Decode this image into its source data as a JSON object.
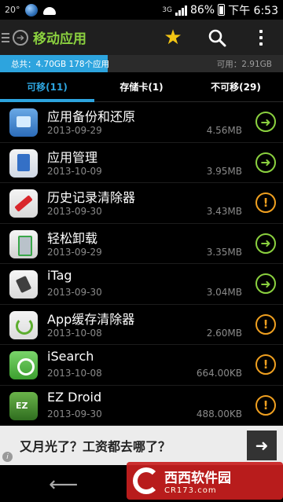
{
  "status_bar": {
    "temperature": "20°",
    "network_type": "3G",
    "battery": "86%",
    "time": "下午 6:53"
  },
  "action_bar": {
    "title": "移动应用",
    "icons": [
      "menu-icon",
      "app-icon",
      "star-icon",
      "search-icon",
      "overflow-icon"
    ]
  },
  "storage": {
    "total_label": "总共：4.70GB  178个应用",
    "free_label": "可用：2.91GB",
    "used_fraction": 0.38,
    "accent_color": "#2da4de"
  },
  "tabs": [
    {
      "label": "可移(11)",
      "active": true
    },
    {
      "label": "存储卡(1)",
      "active": false
    },
    {
      "label": "不可移(29)",
      "active": false
    }
  ],
  "apps": [
    {
      "name": "应用备份和还原",
      "date": "2013-09-29",
      "size": "4.56MB",
      "status": "move"
    },
    {
      "name": "应用管理",
      "date": "2013-10-09",
      "size": "3.95MB",
      "status": "move"
    },
    {
      "name": "历史记录清除器",
      "date": "2013-09-30",
      "size": "3.43MB",
      "status": "warn"
    },
    {
      "name": "轻松卸载",
      "date": "2013-09-29",
      "size": "3.35MB",
      "status": "move"
    },
    {
      "name": "iTag",
      "date": "2013-09-30",
      "size": "3.04MB",
      "status": "move"
    },
    {
      "name": "App缓存清除器",
      "date": "2013-10-08",
      "size": "2.60MB",
      "status": "warn"
    },
    {
      "name": "iSearch",
      "date": "2013-10-08",
      "size": "664.00KB",
      "status": "warn"
    },
    {
      "name": "EZ Droid",
      "date": "2013-09-30",
      "size": "488.00KB",
      "status": "warn"
    }
  ],
  "ad": {
    "text": "又月光了？工资都去哪了？"
  },
  "watermark": {
    "title": "西西软件园",
    "url": "CR173.com"
  }
}
